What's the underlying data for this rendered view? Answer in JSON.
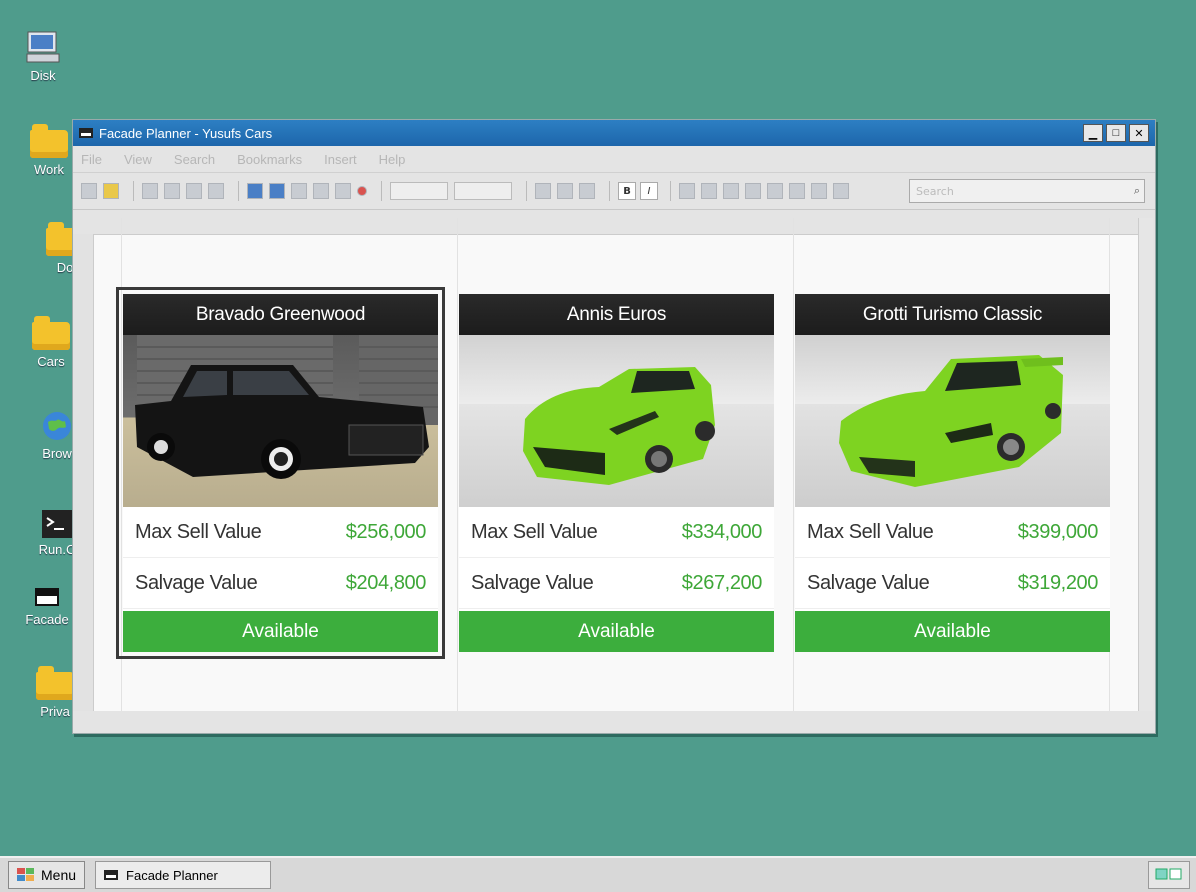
{
  "desktop": {
    "icons": [
      {
        "label": "Disk",
        "icon": "computer-icon"
      },
      {
        "label": "Work",
        "icon": "folder-icon"
      },
      {
        "label": "Do",
        "icon": "folder-icon"
      },
      {
        "label": "Cars",
        "icon": "folder-icon"
      },
      {
        "label": "Brow",
        "icon": "globe-icon"
      },
      {
        "label": "Run.C",
        "icon": "terminal-icon"
      },
      {
        "label": "Facade",
        "icon": "facade-icon"
      },
      {
        "label": "Priva",
        "icon": "folder-icon"
      }
    ]
  },
  "window": {
    "title": "Facade Planner - Yusufs Cars",
    "menu": [
      "File",
      "View",
      "Search",
      "Bookmarks",
      "Insert",
      "Help"
    ],
    "search_placeholder": "Search"
  },
  "cards": [
    {
      "name": "Bravado Greenwood",
      "max_sell_label": "Max Sell Value",
      "max_sell_value": "$256,000",
      "salvage_label": "Salvage Value",
      "salvage_value": "$204,800",
      "status": "Available",
      "car_color": "#1a1a1a"
    },
    {
      "name": "Annis Euros",
      "max_sell_label": "Max Sell Value",
      "max_sell_value": "$334,000",
      "salvage_label": "Salvage Value",
      "salvage_value": "$267,200",
      "status": "Available",
      "car_color": "#7ed321"
    },
    {
      "name": "Grotti Turismo Classic",
      "max_sell_label": "Max Sell Value",
      "max_sell_value": "$399,000",
      "salvage_label": "Salvage Value",
      "salvage_value": "$319,200",
      "status": "Available",
      "car_color": "#7ed321"
    }
  ],
  "taskbar": {
    "menu_label": "Menu",
    "task_label": "Facade Planner"
  },
  "colors": {
    "accent_green": "#3cae3d",
    "value_green": "#3ea738",
    "titlebar_blue": "#1d66ab",
    "desktop": "#4f9c8c"
  }
}
